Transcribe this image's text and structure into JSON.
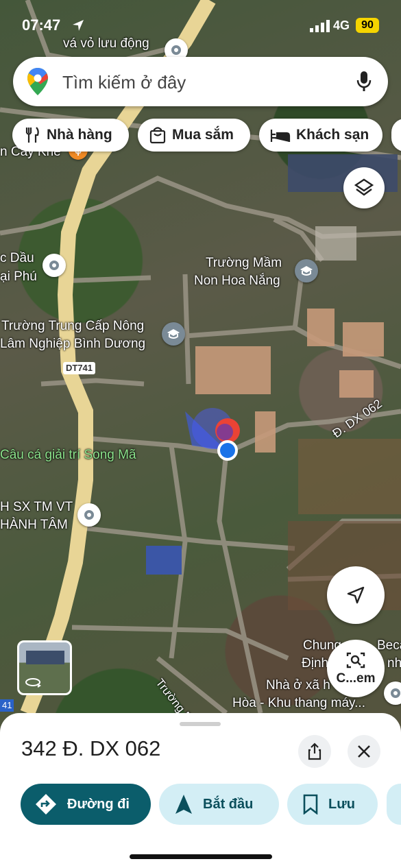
{
  "status_bar": {
    "time": "07:47",
    "network": "4G",
    "battery": "90"
  },
  "search": {
    "placeholder": "Tìm kiếm ở đây"
  },
  "chips": [
    {
      "label": "Nhà hàng",
      "icon": "fork-knife-icon"
    },
    {
      "label": "Mua sắm",
      "icon": "shopping-bag-icon"
    },
    {
      "label": "Khách sạn",
      "icon": "bed-icon"
    }
  ],
  "map_labels": {
    "top_place": "vá vỏ lưu động",
    "cay_khe": "n Cây Khế",
    "c_dau": "c Dầu",
    "ai_phu": "ại Phú",
    "mam_non_1": "Trường Mầm",
    "mam_non_2": "Non Hoa Nắng",
    "trung_cap_1": "Trường Trung Cấp Nông",
    "trung_cap_2": "Lâm Nghiệp Bình Dương",
    "road_dt741": "DT741",
    "road_dx062": "Đ. DX 062",
    "cau_ca": "Câu cá giải trí Song Mã",
    "sx_1": "H SX TM VT",
    "sx_2": "HÀNH TÂM",
    "chung_1": "Chung",
    "chung_1b": "Beca",
    "chung_2": "Định",
    "chung_2b": "nh",
    "nha_o_1": "Nhà ở xã h",
    "nha_o_2": "Hòa - Khu thang máy...",
    "truong_bong": "Trường Bông",
    "left_41": "41",
    "lens_label": "C...em"
  },
  "place": {
    "title": "342 Đ. DX 062"
  },
  "actions": [
    {
      "label": "Đường đi",
      "icon": "directions-icon"
    },
    {
      "label": "Bắt đầu",
      "icon": "navigation-arrow-icon"
    },
    {
      "label": "Lưu",
      "icon": "bookmark-icon"
    }
  ],
  "colors": {
    "primary": "#0b5d6b",
    "action_bg": "#d3eef5",
    "location_blue": "#1a73e8",
    "pin_red": "#ea4335",
    "road": "#f3dfa0"
  }
}
